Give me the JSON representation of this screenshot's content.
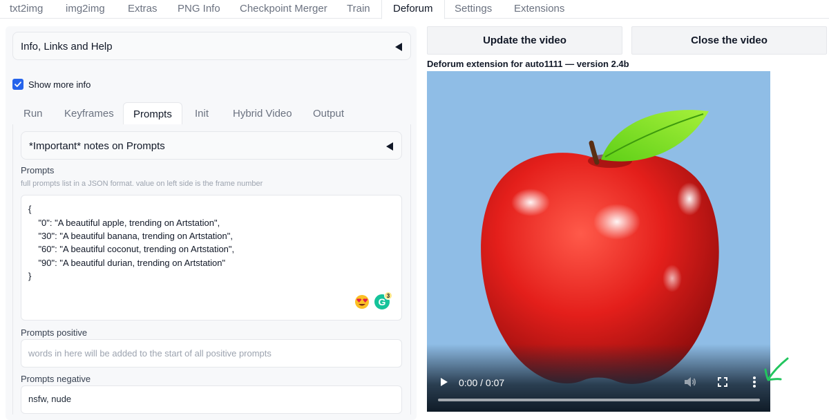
{
  "nav": {
    "tabs": [
      "txt2img",
      "img2img",
      "Extras",
      "PNG Info",
      "Checkpoint Merger",
      "Train",
      "Deforum",
      "Settings",
      "Extensions"
    ],
    "active": "Deforum"
  },
  "left": {
    "info_accordion": "Info, Links and Help",
    "show_more_info": {
      "label": "Show more info",
      "checked": true
    },
    "subtabs": [
      "Run",
      "Keyframes",
      "Prompts",
      "Init",
      "Hybrid Video",
      "Output"
    ],
    "active_subtab": "Prompts",
    "notes_accordion": "*Important* notes on Prompts",
    "prompts": {
      "label": "Prompts",
      "hint": "full prompts list in a JSON format. value on left side is the frame number",
      "lines": [
        "{",
        "    \"0\": \"A beautiful apple, trending on Artstation\",",
        "    \"30\": \"A beautiful banana, trending on Artstation\",",
        "    \"60\": \"A beautiful coconut, trending on Artstation\",",
        "    \"90\": \"A beautiful durian, trending on Artstation\"",
        "}"
      ],
      "grammarly_count": "3"
    },
    "prompts_positive": {
      "label": "Prompts positive",
      "placeholder": "words in here will be added to the start of all positive prompts",
      "value": ""
    },
    "prompts_negative": {
      "label": "Prompts negative",
      "value": "nsfw, nude"
    }
  },
  "right": {
    "update_button": "Update the video",
    "close_button": "Close the video",
    "extension_title": "Deforum extension for auto1111 — version 2.4b",
    "video": {
      "time": "0:00 / 0:07",
      "progress": 0
    }
  },
  "colors": {
    "accent": "#2563eb",
    "video_bg": "#8fbde6",
    "annotation_arrow": "#22c55e"
  }
}
